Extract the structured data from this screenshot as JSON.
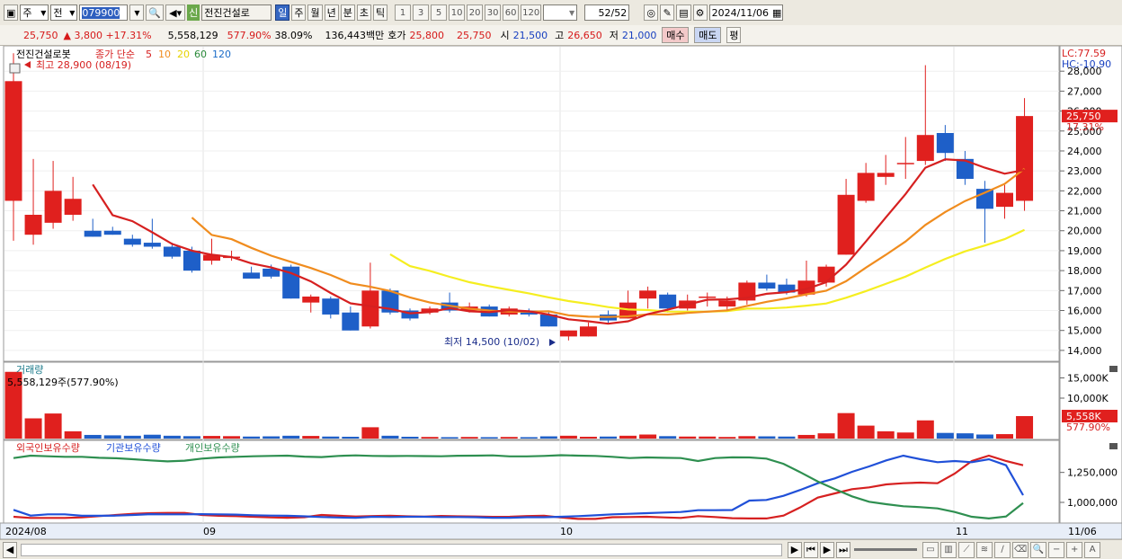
{
  "toolbar": {
    "type_select": "주",
    "market_select": "전",
    "code": "079900",
    "new_badge": "신",
    "stock_name": "전진건설로",
    "periods": [
      "일",
      "주",
      "월",
      "년",
      "분",
      "초",
      "틱"
    ],
    "active_period": "일",
    "multipliers": [
      "1",
      "3",
      "5",
      "10",
      "20",
      "30",
      "60",
      "120"
    ],
    "page_value": "52",
    "page_total": "/52",
    "date": "2024/11/06"
  },
  "quote": {
    "price": "25,750",
    "change": "▲ 3,800 +17.31%",
    "volume": "5,558,129",
    "volume_pct": "577.90%",
    "turnover_pct": "38.09%",
    "amount": "136,443백만",
    "hoga_label": "호가",
    "ask": "25,800",
    "bid": "25,750",
    "open_label": "시",
    "open": "21,500",
    "high_label": "고",
    "high": "26,650",
    "low_label": "저",
    "low": "21,000",
    "buy_button": "매수",
    "sell_button": "매도",
    "eval_button": "평"
  },
  "price_panel": {
    "legend_name": "전진건설로봇",
    "ma_label": "종가 단순",
    "ma_periods": [
      "5",
      "10",
      "20",
      "60",
      "120"
    ],
    "ma_colors": [
      "#d62020",
      "#f08c1e",
      "#f0e000",
      "#2a8a3a",
      "#1c6cc8"
    ],
    "max_note": "최고 28,900 (08/19)",
    "min_note": "최저 14,500 (10/02)",
    "lc": "LC:77.59",
    "hc": "HC:-10.90",
    "current_price": "25,750",
    "current_pct": "17.31%",
    "y_ticks": [
      "28,000",
      "27,000",
      "26,000",
      "25,000",
      "24,000",
      "23,000",
      "22,000",
      "21,000",
      "20,000",
      "19,000",
      "18,000",
      "17,000",
      "16,000",
      "15,000",
      "14,000"
    ]
  },
  "volume_panel": {
    "title": "거래량",
    "info": "5,558,129주(577.90%)",
    "y_ticks": [
      "15,000K",
      "10,000K"
    ],
    "current": "5,558K",
    "current_pct": "577.90%"
  },
  "holdings_panel": {
    "legend": [
      "외국인보유수량",
      "기관보유수량",
      "개인보유수량"
    ],
    "colors": [
      "#d62020",
      "#2050d8",
      "#2e8f50"
    ],
    "y_ticks": [
      "1,250,000",
      "1,000,000"
    ]
  },
  "x_axis": {
    "labels": [
      "2024/08",
      "09",
      "10",
      "11"
    ],
    "right_label": "11/06"
  },
  "chart_data": [
    {
      "type": "candlestick",
      "title": "전진건설로봇",
      "ylim": [
        13500,
        29000
      ],
      "candles": [
        {
          "o": 21500,
          "h": 28900,
          "l": 19500,
          "c": 27500
        },
        {
          "o": 19800,
          "h": 23600,
          "l": 19300,
          "c": 20800
        },
        {
          "o": 20400,
          "h": 23500,
          "l": 20100,
          "c": 22000
        },
        {
          "o": 20800,
          "h": 22700,
          "l": 20500,
          "c": 21600
        },
        {
          "o": 20000,
          "h": 20600,
          "l": 19700,
          "c": 19700
        },
        {
          "o": 20000,
          "h": 20200,
          "l": 19800,
          "c": 19800
        },
        {
          "o": 19600,
          "h": 19800,
          "l": 19200,
          "c": 19300
        },
        {
          "o": 19400,
          "h": 20600,
          "l": 19100,
          "c": 19200
        },
        {
          "o": 19200,
          "h": 19400,
          "l": 18600,
          "c": 18700
        },
        {
          "o": 19000,
          "h": 19200,
          "l": 17900,
          "c": 18000
        },
        {
          "o": 18500,
          "h": 19600,
          "l": 18300,
          "c": 18800
        },
        {
          "o": 18700,
          "h": 19000,
          "l": 18500,
          "c": 18700
        },
        {
          "o": 17900,
          "h": 18200,
          "l": 17600,
          "c": 17600
        },
        {
          "o": 18100,
          "h": 18300,
          "l": 17600,
          "c": 17700
        },
        {
          "o": 18200,
          "h": 18300,
          "l": 16600,
          "c": 16600
        },
        {
          "o": 16400,
          "h": 16800,
          "l": 15900,
          "c": 16700
        },
        {
          "o": 16600,
          "h": 16700,
          "l": 15600,
          "c": 15800
        },
        {
          "o": 15900,
          "h": 16200,
          "l": 15000,
          "c": 15000
        },
        {
          "o": 15200,
          "h": 18400,
          "l": 15100,
          "c": 17000
        },
        {
          "o": 17000,
          "h": 17100,
          "l": 15800,
          "c": 15900
        },
        {
          "o": 16000,
          "h": 16100,
          "l": 15500,
          "c": 15600
        },
        {
          "o": 15900,
          "h": 16200,
          "l": 15800,
          "c": 16100
        },
        {
          "o": 16400,
          "h": 16900,
          "l": 15900,
          "c": 16000
        },
        {
          "o": 16000,
          "h": 16400,
          "l": 15900,
          "c": 16200
        },
        {
          "o": 16200,
          "h": 16300,
          "l": 15700,
          "c": 15700
        },
        {
          "o": 15800,
          "h": 16200,
          "l": 15700,
          "c": 16100
        },
        {
          "o": 16000,
          "h": 16100,
          "l": 15700,
          "c": 15800
        },
        {
          "o": 15800,
          "h": 16000,
          "l": 15200,
          "c": 15200
        },
        {
          "o": 14700,
          "h": 15000,
          "l": 14500,
          "c": 15000
        },
        {
          "o": 14700,
          "h": 15400,
          "l": 14700,
          "c": 15200
        },
        {
          "o": 15800,
          "h": 16000,
          "l": 15300,
          "c": 15500
        },
        {
          "o": 15600,
          "h": 17000,
          "l": 15600,
          "c": 16400
        },
        {
          "o": 16600,
          "h": 17200,
          "l": 16100,
          "c": 17000
        },
        {
          "o": 16800,
          "h": 16900,
          "l": 15900,
          "c": 16100
        },
        {
          "o": 16100,
          "h": 16800,
          "l": 16000,
          "c": 16500
        },
        {
          "o": 16700,
          "h": 16900,
          "l": 16200,
          "c": 16700
        },
        {
          "o": 16200,
          "h": 16700,
          "l": 16000,
          "c": 16500
        },
        {
          "o": 16500,
          "h": 17500,
          "l": 16300,
          "c": 17400
        },
        {
          "o": 17400,
          "h": 17800,
          "l": 17000,
          "c": 17100
        },
        {
          "o": 17300,
          "h": 17600,
          "l": 16800,
          "c": 16900
        },
        {
          "o": 16800,
          "h": 18500,
          "l": 16700,
          "c": 17500
        },
        {
          "o": 17400,
          "h": 18300,
          "l": 17200,
          "c": 18200
        },
        {
          "o": 18800,
          "h": 22600,
          "l": 18800,
          "c": 21800
        },
        {
          "o": 21500,
          "h": 23400,
          "l": 21400,
          "c": 22900
        },
        {
          "o": 22700,
          "h": 23800,
          "l": 22300,
          "c": 22900
        },
        {
          "o": 23400,
          "h": 24700,
          "l": 22600,
          "c": 23400
        },
        {
          "o": 23500,
          "h": 28300,
          "l": 23300,
          "c": 24800
        },
        {
          "o": 24900,
          "h": 25300,
          "l": 23500,
          "c": 23900
        },
        {
          "o": 23600,
          "h": 24000,
          "l": 22300,
          "c": 22600
        },
        {
          "o": 22100,
          "h": 22500,
          "l": 19400,
          "c": 21100
        },
        {
          "o": 21200,
          "h": 22300,
          "l": 20600,
          "c": 21900
        },
        {
          "o": 21500,
          "h": 26650,
          "l": 21000,
          "c": 25750
        }
      ],
      "ma20_start": 9,
      "ma60_start": 19
    },
    {
      "type": "bar",
      "title": "거래량",
      "unit": "K shares",
      "ylim": [
        0,
        18000
      ],
      "values": [
        16500,
        5000,
        6200,
        1800,
        900,
        800,
        700,
        950,
        700,
        600,
        650,
        600,
        500,
        550,
        700,
        650,
        500,
        450,
        2800,
        700,
        450,
        400,
        350,
        400,
        350,
        400,
        350,
        550,
        700,
        450,
        500,
        700,
        1000,
        600,
        500,
        500,
        400,
        600,
        550,
        500,
        900,
        1300,
        6300,
        3200,
        1800,
        1500,
        4500,
        1400,
        1300,
        1000,
        1100,
        5558
      ]
    },
    {
      "type": "line",
      "title": "보유수량",
      "ylim": [
        850000,
        1420000
      ],
      "series": [
        {
          "name": "외국인보유수량",
          "values": [
            880000,
            870000,
            870000,
            870000,
            875000,
            885000,
            895000,
            905000,
            910000,
            912000,
            912000,
            895000,
            888000,
            885000,
            880000,
            875000,
            872000,
            876000,
            895000,
            888000,
            882000,
            886000,
            888000,
            884000,
            881000,
            887000,
            884000,
            882000,
            879000,
            880000,
            886000,
            888000,
            874000,
            862000,
            862000,
            876000,
            878000,
            880000,
            875000,
            870000,
            885000,
            878000,
            868000,
            866000,
            866000,
            890000,
            960000,
            1040000,
            1075000,
            1110000,
            1125000,
            1150000,
            1160000,
            1165000,
            1160000,
            1240000,
            1345000,
            1390000,
            1345000,
            1310000
          ]
        },
        {
          "name": "기관보유수량",
          "values": [
            938000,
            890000,
            900000,
            900000,
            888000,
            888000,
            890000,
            895000,
            902000,
            900000,
            900000,
            902000,
            900000,
            898000,
            893000,
            890000,
            888000,
            884000,
            878000,
            874000,
            872000,
            880000,
            878000,
            880000,
            880000,
            878000,
            878000,
            876000,
            872000,
            872000,
            876000,
            876000,
            880000,
            885000,
            892000,
            900000,
            905000,
            910000,
            915000,
            920000,
            935000,
            935000,
            936000,
            1015000,
            1020000,
            1055000,
            1105000,
            1160000,
            1200000,
            1255000,
            1300000,
            1350000,
            1390000,
            1360000,
            1335000,
            1345000,
            1335000,
            1360000,
            1310000,
            1060000
          ]
        },
        {
          "name": "개인보유수량",
          "values": [
            1370000,
            1390000,
            1385000,
            1380000,
            1380000,
            1372000,
            1368000,
            1360000,
            1350000,
            1342000,
            1348000,
            1365000,
            1375000,
            1380000,
            1385000,
            1388000,
            1390000,
            1382000,
            1378000,
            1388000,
            1392000,
            1388000,
            1386000,
            1388000,
            1386000,
            1385000,
            1389000,
            1390000,
            1392000,
            1384000,
            1384000,
            1388000,
            1394000,
            1390000,
            1388000,
            1380000,
            1370000,
            1375000,
            1372000,
            1370000,
            1345000,
            1370000,
            1376000,
            1375000,
            1365000,
            1322000,
            1250000,
            1175000,
            1110000,
            1050000,
            1005000,
            985000,
            968000,
            960000,
            950000,
            920000,
            880000,
            866000,
            882000,
            995000
          ]
        }
      ]
    }
  ]
}
